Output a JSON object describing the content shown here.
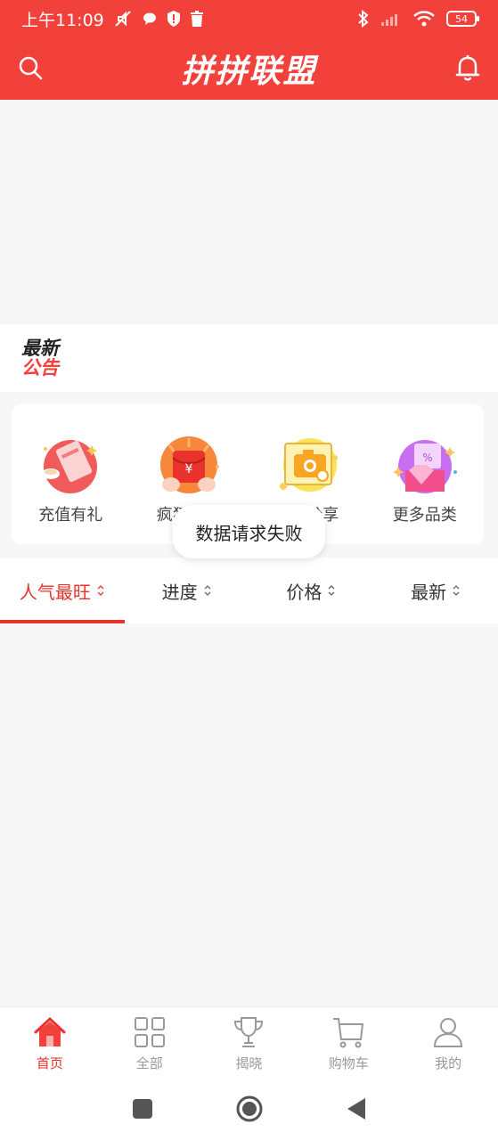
{
  "status_bar": {
    "time": "上午11:09",
    "battery": "54"
  },
  "header": {
    "title": "拼拼联盟",
    "icons": [
      "search-icon",
      "bell-icon"
    ]
  },
  "notice": {
    "logo_line1": "最新",
    "logo_line2": "公告"
  },
  "categories": [
    {
      "label": "充值有礼",
      "icon": "recharge-gift-icon"
    },
    {
      "label": "疯狂红包",
      "icon": "red-packet-icon"
    },
    {
      "label": "晒单分享",
      "icon": "camera-share-icon"
    },
    {
      "label": "更多品类",
      "icon": "more-categories-icon"
    }
  ],
  "toast": "数据请求失败",
  "sort_tabs": [
    {
      "label": "人气最旺",
      "active": true
    },
    {
      "label": "进度",
      "active": false
    },
    {
      "label": "价格",
      "active": false
    },
    {
      "label": "最新",
      "active": false
    }
  ],
  "bottom_tabs": [
    {
      "label": "首页",
      "icon": "home-icon",
      "active": true
    },
    {
      "label": "全部",
      "icon": "grid-icon",
      "active": false
    },
    {
      "label": "揭晓",
      "icon": "trophy-icon",
      "active": false
    },
    {
      "label": "购物车",
      "icon": "cart-icon",
      "active": false
    },
    {
      "label": "我的",
      "icon": "user-icon",
      "active": false
    }
  ],
  "colors": {
    "brand": "#f2413a",
    "active": "#e8322b",
    "inactive": "#999999"
  }
}
